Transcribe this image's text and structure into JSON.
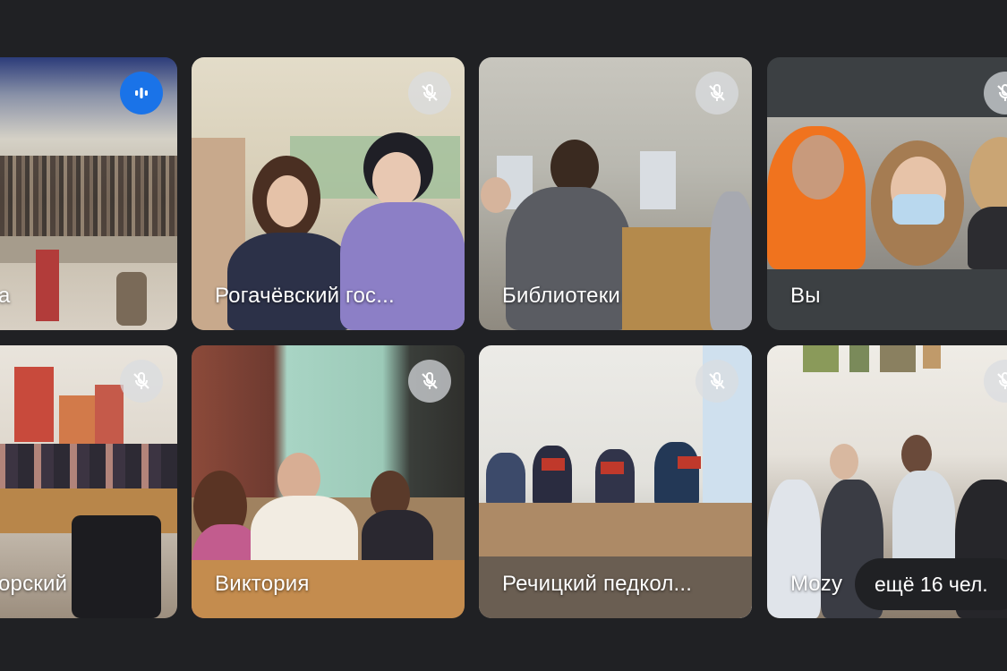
{
  "tiles": [
    {
      "label": "а",
      "mic": "speaking"
    },
    {
      "label": "Рогачёвский гос...",
      "mic": "muted"
    },
    {
      "label": "Библиотеки",
      "mic": "muted"
    },
    {
      "label": "Вы",
      "mic": "muted"
    },
    {
      "label": "орский",
      "mic": "muted"
    },
    {
      "label": "Виктория",
      "mic": "muted"
    },
    {
      "label": "Речицкий педкол...",
      "mic": "muted"
    },
    {
      "label": "Mozy",
      "mic": "muted"
    }
  ],
  "more_participants": "ещё 16 чел.",
  "icons": {
    "muted": "mic-off-icon",
    "speaking": "audio-level-icon"
  },
  "colors": {
    "background": "#202124",
    "tile": "#3c4043",
    "speaking": "#1a73e8",
    "mute_button": "#dadce0"
  }
}
